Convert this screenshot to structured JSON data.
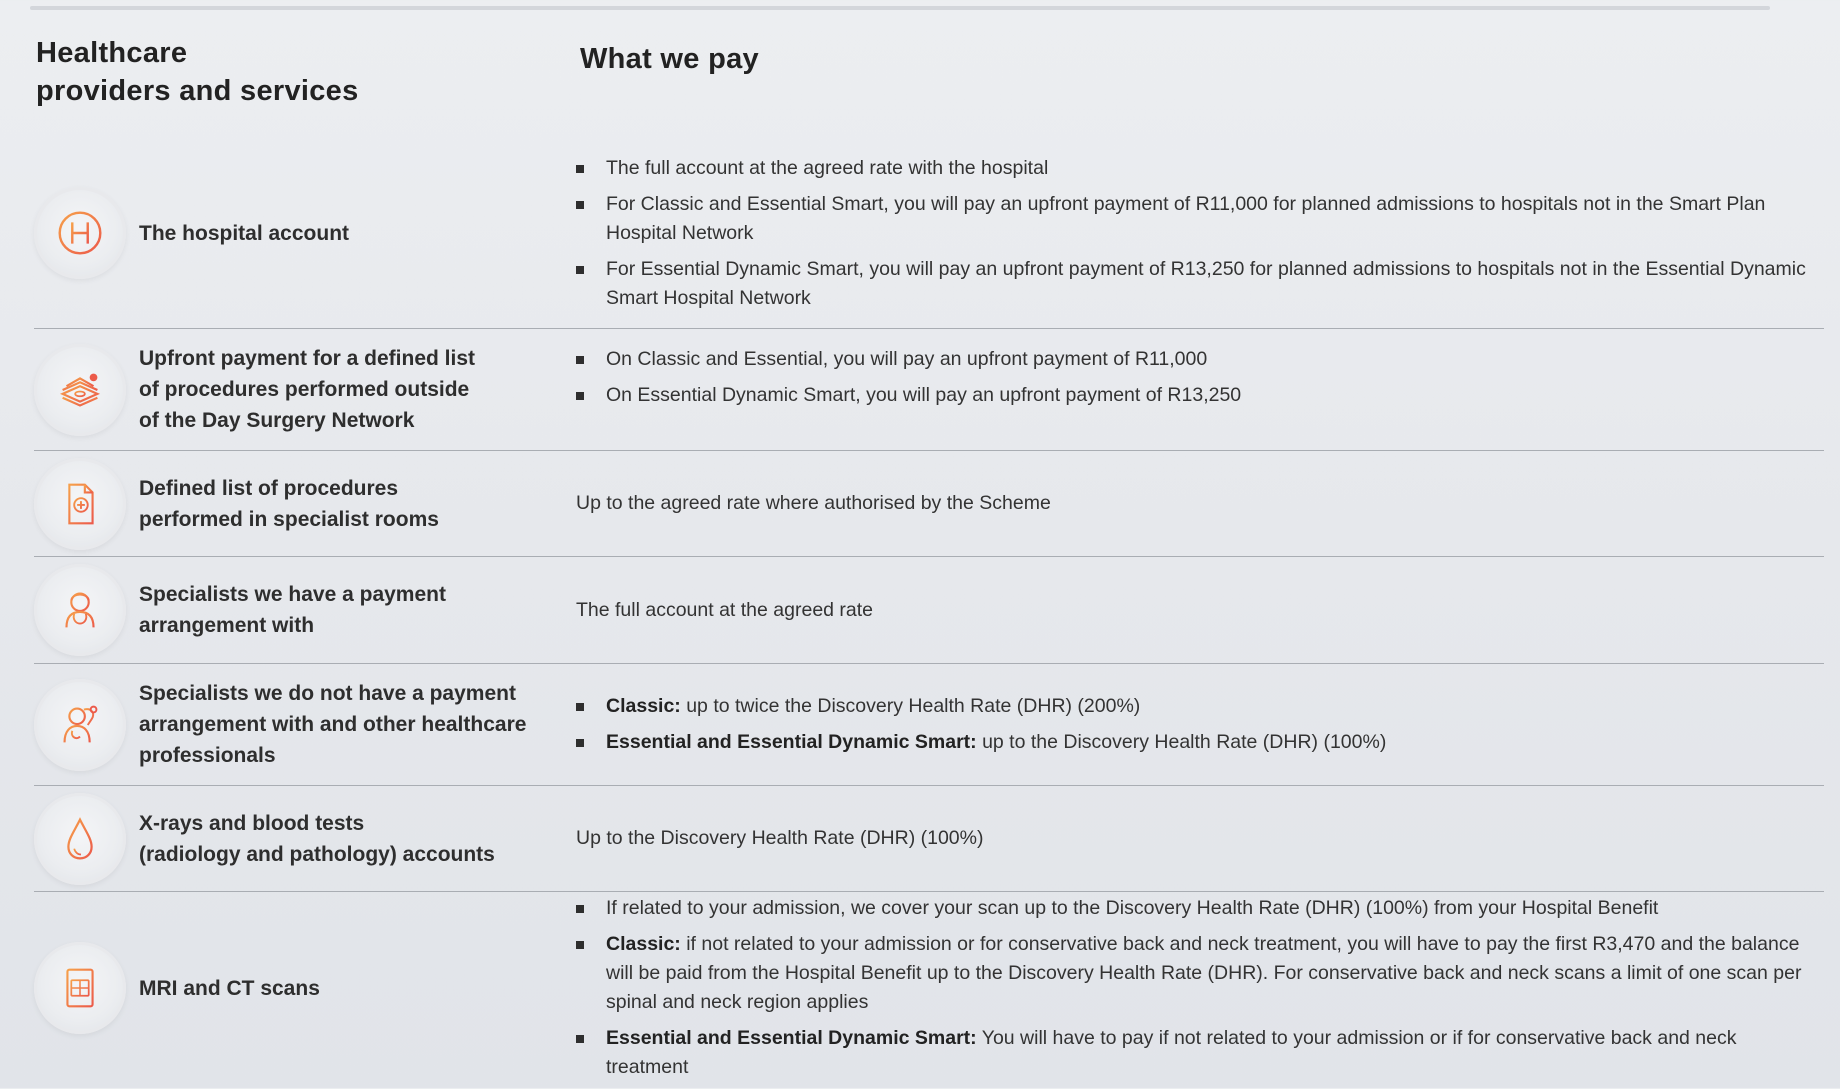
{
  "headings": {
    "left_line1": "Healthcare",
    "left_line2": "providers and services",
    "right": "What we pay"
  },
  "rows": [
    {
      "icon": "hospital-icon",
      "label": [
        "The hospital account"
      ],
      "bullets": [
        {
          "bold": "",
          "text": "The full account at the agreed rate with the hospital"
        },
        {
          "bold": "",
          "text": "For Classic and Essential Smart, you will pay an upfront payment of R11,000 for planned admissions to hospitals not in the Smart Plan Hospital Network"
        },
        {
          "bold": "",
          "text": "For Essential Dynamic Smart, you will pay an upfront payment of R13,250 for planned admissions to hospitals not in the Essential Dynamic Smart Hospital Network"
        }
      ]
    },
    {
      "icon": "money-stack-icon",
      "label": [
        "Upfront payment for a defined list",
        "of procedures performed outside",
        "of the Day Surgery Network"
      ],
      "bullets": [
        {
          "bold": "",
          "text": "On Classic and Essential, you will pay an upfront payment of R11,000"
        },
        {
          "bold": "",
          "text": "On Essential Dynamic Smart, you will pay an upfront payment of R13,250"
        }
      ]
    },
    {
      "icon": "medical-document-icon",
      "label": [
        "Defined list of procedures",
        "performed in specialist rooms"
      ],
      "text": "Up to the agreed rate where authorised by the Scheme"
    },
    {
      "icon": "doctor-icon",
      "label": [
        "Specialists we have a payment",
        "arrangement with"
      ],
      "text": "The full account at the agreed rate"
    },
    {
      "icon": "specialist-stethoscope-icon",
      "label": [
        "Specialists we do not have a payment",
        "arrangement with and other healthcare",
        "professionals"
      ],
      "bullets": [
        {
          "bold": "Classic:",
          "text": " up to twice the Discovery Health Rate (DHR) (200%)"
        },
        {
          "bold": "Essential and Essential Dynamic Smart:",
          "text": " up to the Discovery Health Rate (DHR) (100%)"
        }
      ]
    },
    {
      "icon": "blood-drop-icon",
      "label": [
        "X-rays and blood tests",
        "(radiology and pathology) accounts"
      ],
      "text": "Up to the Discovery Health Rate (DHR) (100%)"
    },
    {
      "icon": "scan-icon",
      "label": [
        "MRI and CT scans"
      ],
      "bullets": [
        {
          "bold": "",
          "text": "If related to your admission, we cover your scan up to the Discovery Health Rate (DHR) (100%) from your Hospital Benefit"
        },
        {
          "bold": "Classic:",
          "text": " if not related to your admission or for conservative back and neck treatment, you will have to pay the first R3,470 and the balance will be paid from the Hospital Benefit up to the Discovery Health Rate (DHR). For conservative back and neck scans a limit of one scan per spinal and neck region applies"
        },
        {
          "bold": "Essential and Essential Dynamic Smart:",
          "text": " You will have to pay if not related to your admission or if for conservative back and neck treatment"
        }
      ]
    }
  ],
  "colors": {
    "icon_orange": "#f08a3c",
    "icon_red": "#ec5a4a",
    "text": "#2b2b2b",
    "divider": "#a9adb3"
  }
}
